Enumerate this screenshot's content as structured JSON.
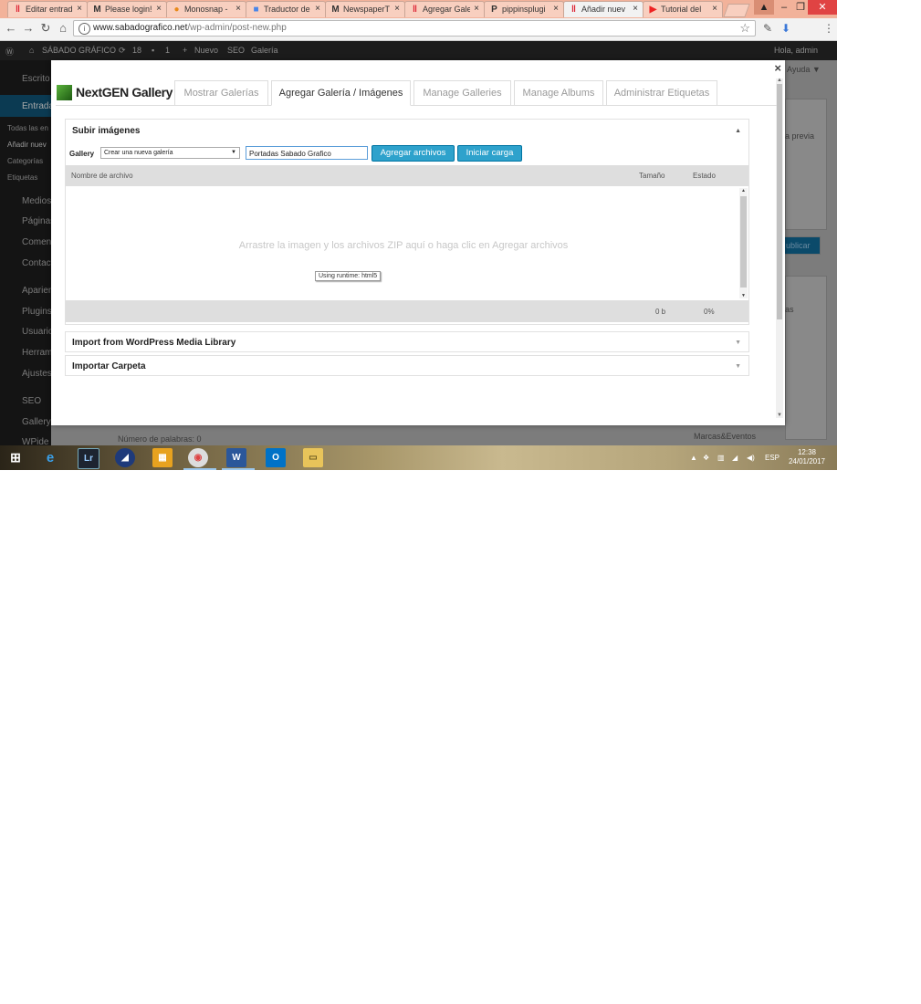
{
  "browser": {
    "tabs": [
      {
        "title": "Editar entrad",
        "favicon": "wp-icon"
      },
      {
        "title": "Please login!",
        "favicon": "m-icon"
      },
      {
        "title": "Monosnap -",
        "favicon": "monosnap-icon"
      },
      {
        "title": "Traductor de",
        "favicon": "translate-icon"
      },
      {
        "title": "NewspaperT",
        "favicon": "m-icon"
      },
      {
        "title": "Agregar Gale",
        "favicon": "wp-icon"
      },
      {
        "title": "pippinsplugi",
        "favicon": "p-icon"
      },
      {
        "title": "Añadir nuev",
        "favicon": "wp-icon",
        "active": true
      },
      {
        "title": "Tutorial del",
        "favicon": "youtube-icon"
      }
    ],
    "url_domain": "www.sabadografico.net",
    "url_path": "/wp-admin/post-new.php"
  },
  "wp_background": {
    "adminbar": {
      "site": "SÁBADO GRÁFICO",
      "updates": "18",
      "comments": "1",
      "new": "Nuevo",
      "seo": "SEO",
      "gallery": "Galería",
      "greeting": "Hola, admin"
    },
    "sidebar": [
      "Escrito",
      "Entrada",
      "Todas las en",
      "Añadir nuev",
      "Categorías",
      "Etiquetas",
      "Medios",
      "Páginas",
      "Coment",
      "Contact",
      "Aparien",
      "Plugins",
      "Usuario",
      "Herram",
      "Ajustes",
      "SEO",
      "Gallery",
      "WPide"
    ],
    "fragments": {
      "help": "Ayuda ▼",
      "preview": "a previa",
      "publish": "ublicar",
      "cats": "as",
      "brands": "Marcas&Eventos",
      "wordcount": "Número de palabras: 0"
    }
  },
  "modal": {
    "close": "×",
    "logo": "NextGEN Gallery",
    "tabs": [
      "Mostrar Galerías",
      "Agregar Galería / Imágenes",
      "Manage Galleries",
      "Manage Albums",
      "Administrar Etiquetas"
    ],
    "active_tab": 1,
    "upload": {
      "title": "Subir imágenes",
      "gallery_label": "Gallery",
      "gallery_select": "Crear una nueva galería",
      "gallery_name": "Portadas Sabado Grafico",
      "add_files": "Agregar archivos",
      "start_upload": "Iniciar carga",
      "col_filename": "Nombre de archivo",
      "col_size": "Tamaño",
      "col_status": "Estado",
      "drop_message": "Arrastre la imagen y los archivos ZIP aquí o haga clic en Agregar archivos",
      "runtime": "Using runtime: html5",
      "total_size": "0 b",
      "total_percent": "0%"
    },
    "import_media": "Import from WordPress Media Library",
    "import_folder": "Importar Carpeta"
  },
  "taskbar": {
    "lang": "ESP",
    "time": "12:38",
    "date": "24/01/2017"
  },
  "colors": {
    "accent": "#2ea2cc",
    "tab_strip": "#f2b29a"
  }
}
